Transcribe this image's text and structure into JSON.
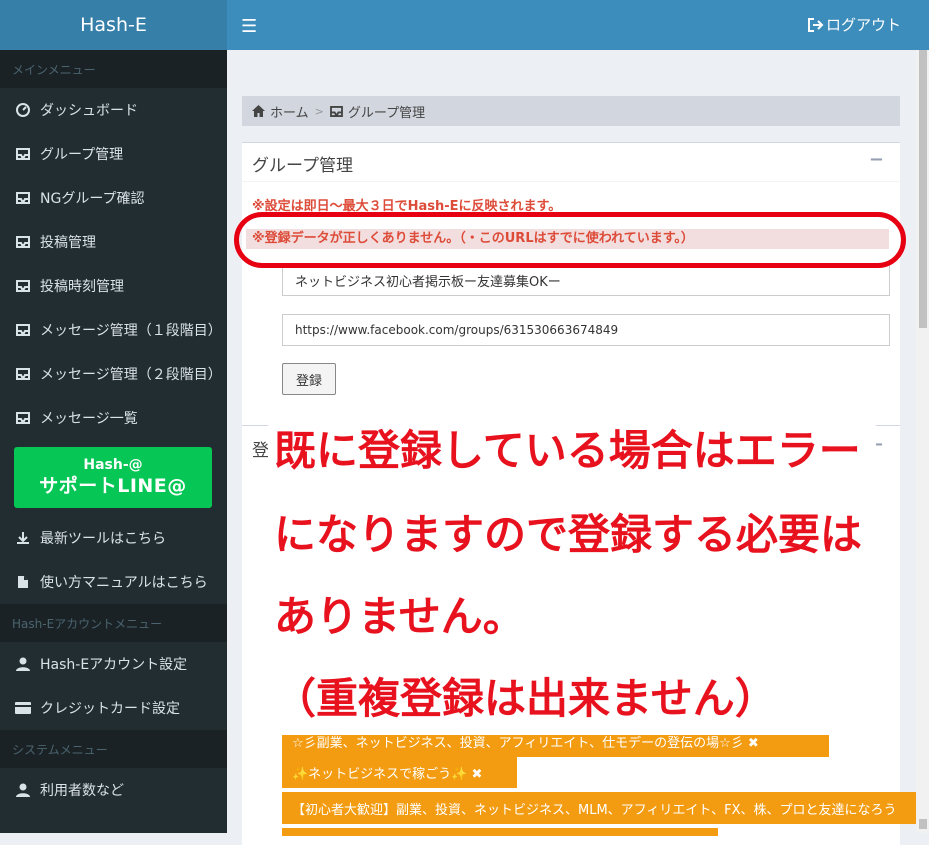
{
  "app": {
    "title": "Hash-E"
  },
  "header": {
    "menu_icon": "hamburger-icon",
    "logout_label": "ログアウト"
  },
  "sidebar": {
    "main_menu_header": "メインメニュー",
    "items": [
      {
        "label": "ダッシュボード",
        "icon": "dashboard-icon"
      },
      {
        "label": "グループ管理",
        "icon": "inbox-icon"
      },
      {
        "label": "NGグループ確認",
        "icon": "inbox-icon"
      },
      {
        "label": "投稿管理",
        "icon": "inbox-icon"
      },
      {
        "label": "投稿時刻管理",
        "icon": "inbox-icon"
      },
      {
        "label": "メッセージ管理（１段階目）",
        "icon": "inbox-icon"
      },
      {
        "label": "メッセージ管理（２段階目）",
        "icon": "inbox-icon"
      },
      {
        "label": "メッセージ一覧",
        "icon": "inbox-icon"
      }
    ],
    "line_banner": {
      "line1": "Hash-@",
      "line2": "サポートLINE@"
    },
    "tool_items": [
      {
        "label": "最新ツールはこちら",
        "icon": "download-icon"
      },
      {
        "label": "使い方マニュアルはこちら",
        "icon": "file-icon"
      }
    ],
    "account_menu_header": "Hash-Eアカウントメニュー",
    "account_items": [
      {
        "label": "Hash-Eアカウント設定",
        "icon": "user-icon"
      },
      {
        "label": "クレジットカード設定",
        "icon": "credit-card-icon"
      }
    ],
    "system_menu_header": "システムメニュー",
    "system_items": [
      {
        "label": "利用者数など",
        "icon": "user-icon"
      }
    ]
  },
  "breadcrumb": {
    "home": "ホーム",
    "current": "グループ管理"
  },
  "group_box": {
    "title": "グループ管理",
    "notice": "※設定は即日～最大３日でHash-Eに反映されます。",
    "error": "※登録データが正しくありません。（・このURLはすでに使われています。）",
    "name_value": "ネットビジネス初心者掲示板ー友達募集OKー",
    "url_value": "https://www.facebook.com/groups/631530663674849",
    "submit_label": "登録"
  },
  "registered_box": {
    "title_visible": "登",
    "tags": [
      "☆彡副業、ネットビジネス、投資、アフィリエイト、仕モデーの登伝の場☆彡 ✖",
      "✨ネットビジネスで稼ごう✨ ✖",
      "【初心者大歓迎】副業、投資、ネットビジネス、MLM、アフィリエイト、FX、株、プロと友達になろう"
    ]
  },
  "annotation": {
    "line1": "既に登録している場合はエラー",
    "line2": "になりますので登録する必要は",
    "line3": "ありません。",
    "line4": "（重複登録は出来ません）"
  },
  "colors": {
    "accent": "#3c8dbc",
    "sidebar": "#222d32",
    "error": "#dd4b39",
    "annotation": "#e8121f",
    "tag": "#f39c12",
    "line_green": "#06c755"
  }
}
